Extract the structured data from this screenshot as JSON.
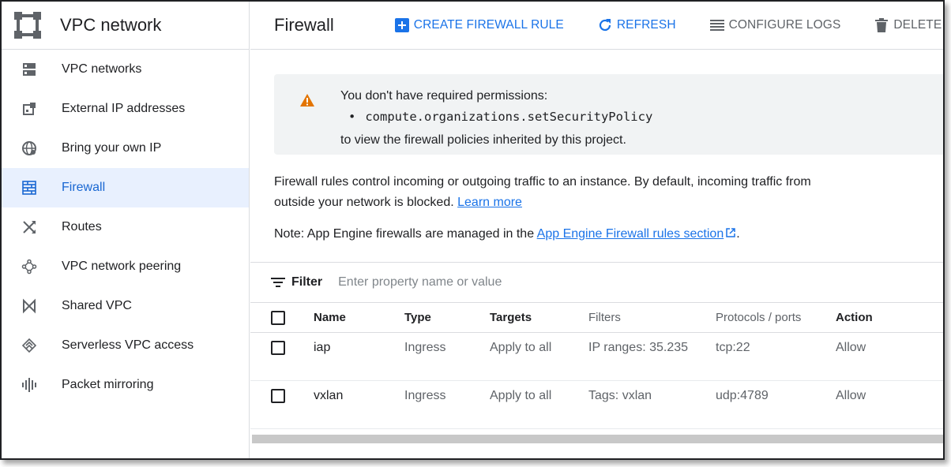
{
  "colors": {
    "accent": "#1a73e8",
    "active_bg": "#e8f0fe",
    "warning": "#e37400",
    "muted_text": "#5f6368"
  },
  "sidebar": {
    "product_title": "VPC network",
    "product_icon": "vpc-network-logo-icon",
    "items": [
      {
        "label": "VPC networks",
        "icon": "vpc-networks-icon",
        "active": false
      },
      {
        "label": "External IP addresses",
        "icon": "external-ip-icon",
        "active": false
      },
      {
        "label": "Bring your own IP",
        "icon": "globe-icon",
        "active": false
      },
      {
        "label": "Firewall",
        "icon": "firewall-brick-icon",
        "active": true
      },
      {
        "label": "Routes",
        "icon": "routes-icon",
        "active": false
      },
      {
        "label": "VPC network peering",
        "icon": "peering-icon",
        "active": false
      },
      {
        "label": "Shared VPC",
        "icon": "shared-vpc-icon",
        "active": false
      },
      {
        "label": "Serverless VPC access",
        "icon": "serverless-vpc-icon",
        "active": false
      },
      {
        "label": "Packet mirroring",
        "icon": "packet-mirroring-icon",
        "active": false
      }
    ]
  },
  "toolbar": {
    "page_title": "Firewall",
    "create_label": "CREATE FIREWALL RULE",
    "refresh_label": "REFRESH",
    "configure_logs_label": "CONFIGURE LOGS",
    "delete_label": "DELETE"
  },
  "warning": {
    "line1": "You don't have required permissions:",
    "permission": "compute.organizations.setSecurityPolicy",
    "line3": "to view the firewall policies inherited by this project."
  },
  "description": {
    "text": "Firewall rules control incoming or outgoing traffic to an instance. By default, incoming traffic from outside your network is blocked.",
    "learn_more": "Learn more"
  },
  "note": {
    "prefix": "Note: App Engine firewalls are managed in the",
    "link": "App Engine Firewall rules section",
    "suffix": "."
  },
  "filter": {
    "label": "Filter",
    "placeholder": "Enter property name or value"
  },
  "table": {
    "columns": [
      "Name",
      "Type",
      "Targets",
      "Filters",
      "Protocols / ports",
      "Action"
    ],
    "rows": [
      {
        "name": "iap",
        "type": "Ingress",
        "targets": "Apply to all",
        "filters": "IP ranges: 35.235",
        "protocols": "tcp:22",
        "action": "Allow"
      },
      {
        "name": "vxlan",
        "type": "Ingress",
        "targets": "Apply to all",
        "filters": "Tags: vxlan",
        "protocols": "udp:4789",
        "action": "Allow"
      }
    ]
  }
}
